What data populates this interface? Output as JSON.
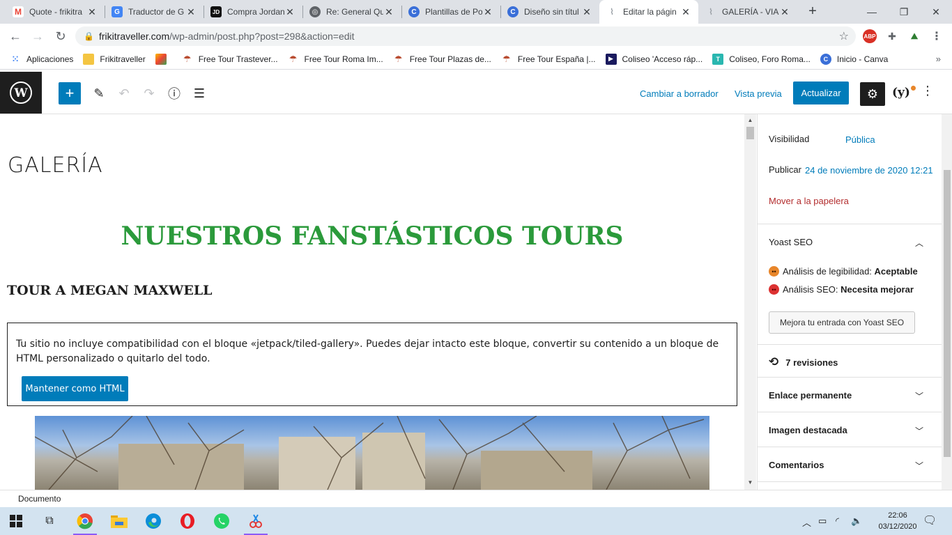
{
  "browser": {
    "tabs": [
      {
        "title": "Quote - frikitra",
        "favicon": "gmail-icon",
        "color": "#ea4335",
        "glyph": "M"
      },
      {
        "title": "Traductor de G",
        "favicon": "translate-icon",
        "color": "#4285f4",
        "glyph": "G"
      },
      {
        "title": "Compra Jordan",
        "favicon": "jd-icon",
        "color": "#111111",
        "glyph": "JD"
      },
      {
        "title": "Re: General Qu",
        "favicon": "globe-icon",
        "color": "#5f6368",
        "glyph": "◎"
      },
      {
        "title": "Plantillas de Po",
        "favicon": "canva-icon",
        "color": "#3a6fd8",
        "glyph": "C"
      },
      {
        "title": "Diseño sin títul",
        "favicon": "canva-icon",
        "color": "#3a6fd8",
        "glyph": "C"
      },
      {
        "title": "Editar la págin",
        "favicon": "frikitraveller-icon",
        "color": "#9aa0a6",
        "glyph": "~",
        "active": true
      },
      {
        "title": "GALERÍA - VIA",
        "favicon": "frikitraveller-icon",
        "color": "#9aa0a6",
        "glyph": "~"
      }
    ],
    "url_host": "frikitraveller.com",
    "url_path": "/wp-admin/post.php?post=298&action=edit",
    "bookmarks": [
      {
        "label": "Aplicaciones",
        "icon": "apps-grid-icon",
        "color": "#4285f4"
      },
      {
        "label": "Frikitraveller",
        "icon": "folder-icon",
        "color": "#f4c542"
      },
      {
        "label": "",
        "icon": "colorful-app-icon",
        "color": "#fbbc04"
      },
      {
        "label": "Free Tour Trastever...",
        "icon": "umbrella-icon",
        "color": "#b84a2e"
      },
      {
        "label": "Free Tour Roma Im...",
        "icon": "umbrella-icon",
        "color": "#b84a2e"
      },
      {
        "label": "Free Tour Plazas de...",
        "icon": "umbrella-icon",
        "color": "#b84a2e"
      },
      {
        "label": "Free Tour España |...",
        "icon": "umbrella-icon",
        "color": "#b84a2e"
      },
      {
        "label": "Coliseo 'Acceso ráp...",
        "icon": "ticket-icon",
        "color": "#1a1a5e"
      },
      {
        "label": "Coliseo, Foro Roma...",
        "icon": "tiqets-icon",
        "color": "#2ab7b0"
      },
      {
        "label": "Inicio - Canva",
        "icon": "canva-icon",
        "color": "#3a6fd8"
      }
    ]
  },
  "editor": {
    "header": {
      "switch_draft": "Cambiar a borrador",
      "preview": "Vista previa",
      "update": "Actualizar"
    },
    "post_title": "GALERÍA",
    "heading": "NUESTROS FANSTÁSTICOS TOURS",
    "subheading": "TOUR A MEGAN MAXWELL",
    "missing_block": {
      "message": "Tu sitio no incluye compatibilidad con el bloque «jetpack/tiled-gallery». Puedes dejar intacto este bloque, convertir su contenido a un bloque de HTML personalizado o quitarlo del todo.",
      "keep_button": "Mantener como HTML"
    },
    "breadcrumb": "Documento"
  },
  "sidebar": {
    "visibility_label": "Visibilidad",
    "visibility_value": "Pública",
    "publish_label": "Publicar",
    "publish_value": "24 de noviembre de 2020 12:21",
    "trash": "Mover a la papelera",
    "yoast": {
      "title": "Yoast SEO",
      "readability_label": "Análisis de legibilidad:",
      "readability_value": "Aceptable",
      "readability_color": "#e8862a",
      "seo_label": "Análisis SEO:",
      "seo_value": "Necesita mejorar",
      "seo_color": "#dc3232",
      "improve_button": "Mejora tu entrada con Yoast SEO"
    },
    "revisions": "7 revisiones",
    "panels": [
      "Enlace permanente",
      "Imagen destacada",
      "Comentarios"
    ]
  },
  "taskbar": {
    "time": "22:06",
    "date": "03/12/2020"
  }
}
